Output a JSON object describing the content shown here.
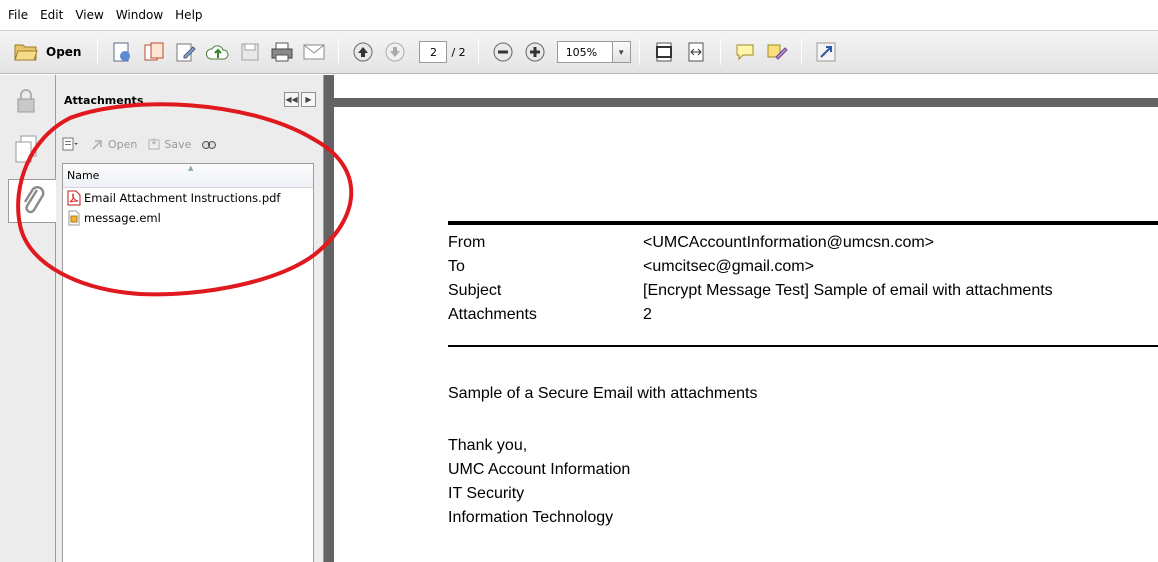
{
  "menubar": {
    "items": [
      "File",
      "Edit",
      "View",
      "Window",
      "Help"
    ]
  },
  "toolbar": {
    "open_label": "Open",
    "current_page": "2",
    "total_pages": "/ 2",
    "zoom": "105%"
  },
  "attachments_panel": {
    "title": "Attachments",
    "tools": {
      "open": "Open",
      "save": "Save"
    },
    "column_header": "Name",
    "files": [
      {
        "name": "Email Attachment Instructions.pdf",
        "icon": "pdf-file-icon"
      },
      {
        "name": "message.eml",
        "icon": "eml-file-icon"
      }
    ]
  },
  "document": {
    "header": [
      {
        "label": "From",
        "value": "<UMCAccountInformation@umcsn.com>"
      },
      {
        "label": "To",
        "value": "<umcitsec@gmail.com>"
      },
      {
        "label": "Subject",
        "value": "[Encrypt Message Test] Sample of email with attachments"
      },
      {
        "label": "Attachments",
        "value": "2"
      }
    ],
    "body": {
      "intro": "Sample of a Secure Email with attachments",
      "closing": "Thank you,",
      "signature": [
        "UMC Account Information",
        "IT Security",
        "Information Technology"
      ]
    }
  },
  "colors": {
    "annotation": "#e0191f",
    "doc_gutter": "#636363"
  }
}
